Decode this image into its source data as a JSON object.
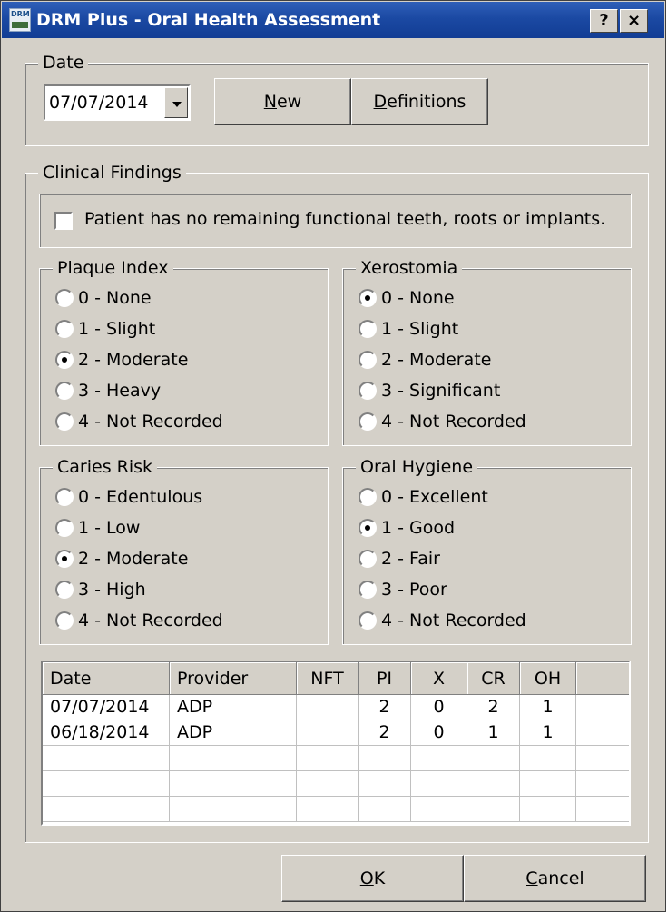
{
  "window": {
    "title": "DRM Plus - Oral Health Assessment",
    "help_label": "?",
    "close_label": "×",
    "icon_text": "DRM"
  },
  "date_group": {
    "legend": "Date",
    "selected_date": "07/07/2014",
    "new_label": "New",
    "new_mnemonic": "N",
    "new_rest": "ew",
    "definitions_mnemonic": "D",
    "definitions_rest": "efinitions"
  },
  "clinical": {
    "legend": "Clinical Findings",
    "no_teeth_label": "Patient has no remaining functional teeth, roots or implants.",
    "no_teeth_checked": false,
    "plaque": {
      "legend": "Plaque Index",
      "selected": 2,
      "options": [
        "0 - None",
        "1 - Slight",
        "2 - Moderate",
        "3 - Heavy",
        "4 - Not Recorded"
      ]
    },
    "xerostomia": {
      "legend": "Xerostomia",
      "selected": 0,
      "options": [
        "0 - None",
        "1 - Slight",
        "2 - Moderate",
        "3 - Significant",
        "4 - Not Recorded"
      ]
    },
    "caries": {
      "legend": "Caries Risk",
      "selected": 2,
      "options": [
        "0 - Edentulous",
        "1 - Low",
        "2 - Moderate",
        "3 - High",
        "4 - Not Recorded"
      ]
    },
    "hygiene": {
      "legend": "Oral Hygiene",
      "selected": 1,
      "options": [
        "0 - Excellent",
        "1 - Good",
        "2 - Fair",
        "3 - Poor",
        "4 - Not Recorded"
      ]
    }
  },
  "history": {
    "columns": [
      "Date",
      "Provider",
      "NFT",
      "PI",
      "X",
      "CR",
      "OH",
      ""
    ],
    "rows": [
      [
        "07/07/2014",
        "ADP",
        "",
        "2",
        "0",
        "2",
        "1",
        ""
      ],
      [
        "06/18/2014",
        "ADP",
        "",
        "2",
        "0",
        "1",
        "1",
        ""
      ],
      [
        "",
        "",
        "",
        "",
        "",
        "",
        "",
        ""
      ],
      [
        "",
        "",
        "",
        "",
        "",
        "",
        "",
        ""
      ],
      [
        "",
        "",
        "",
        "",
        "",
        "",
        "",
        ""
      ]
    ]
  },
  "footer": {
    "ok_mnemonic": "O",
    "ok_rest": "K",
    "cancel_mnemonic": "C",
    "cancel_rest": "ancel"
  }
}
